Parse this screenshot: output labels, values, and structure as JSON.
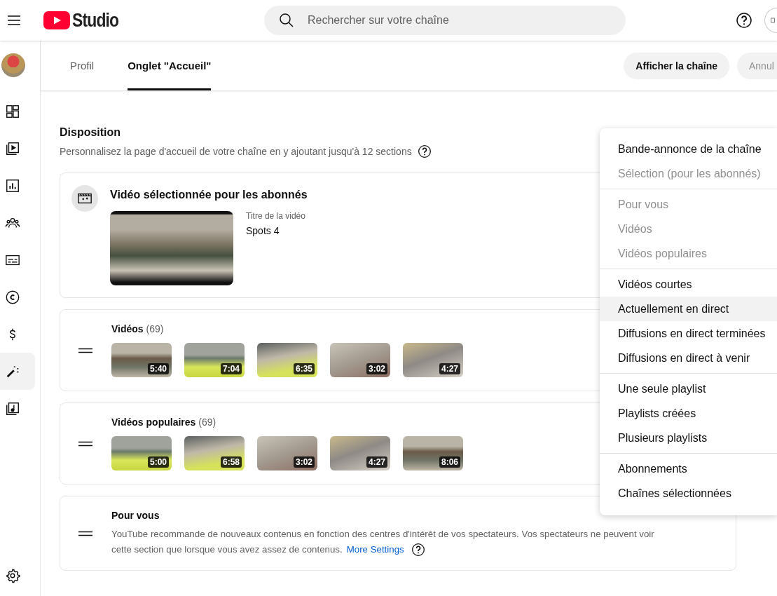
{
  "header": {
    "logo_text": "Studio",
    "search": {
      "placeholder": "Rechercher sur votre chaîne"
    }
  },
  "sidebar": {
    "items": [
      {
        "kind": "dashboard",
        "selected": false
      },
      {
        "kind": "content",
        "selected": false
      },
      {
        "kind": "analytics",
        "selected": false
      },
      {
        "kind": "community",
        "selected": false
      },
      {
        "kind": "subtitles",
        "selected": false
      },
      {
        "kind": "copyright",
        "selected": false
      },
      {
        "kind": "earn",
        "selected": false
      },
      {
        "kind": "customization",
        "selected": true
      },
      {
        "kind": "audio",
        "selected": false
      }
    ]
  },
  "tabs": [
    {
      "label": "Profil",
      "selected": false
    },
    {
      "label": "Onglet \"Accueil\"",
      "selected": true
    }
  ],
  "actions": [
    {
      "label": "Afficher la chaîne",
      "disabled": false
    },
    {
      "label": "Annul",
      "disabled": true
    }
  ],
  "layout": {
    "title": "Disposition",
    "description": "Personnalisez la page d'accueil de votre chaîne en y ajoutant jusqu'à 12 sections",
    "sections": [
      {
        "kind": "featured",
        "title": "Vidéo sélectionnée pour les abonnés",
        "video_label": "Titre de la vidéo",
        "video_title": "Spots 4"
      },
      {
        "kind": "shelf",
        "title": "Vidéos",
        "count": "(69)",
        "durations": [
          "5:40",
          "7:04",
          "6:35",
          "3:02",
          "4:27"
        ]
      },
      {
        "kind": "shelf",
        "title": "Vidéos populaires",
        "count": "(69)",
        "durations": [
          "5:00",
          "6:58",
          "3:02",
          "4:27",
          "8:06"
        ]
      },
      {
        "kind": "info",
        "title": "Pour vous",
        "text": "YouTube recommande de nouveaux contenus en fonction des centres d'intérêt de vos spectateurs. Vos spectateurs ne peuvent voir cette section que lorsque vous avez assez de contenus.",
        "link": "More Settings"
      }
    ]
  },
  "menu": {
    "groups": [
      [
        {
          "label": "Bande-annonce de la chaîne",
          "disabled": false,
          "selected": false
        },
        {
          "label": "Sélection (pour les abonnés)",
          "disabled": true,
          "selected": false
        }
      ],
      [
        {
          "label": "Pour vous",
          "disabled": true,
          "selected": false
        },
        {
          "label": "Vidéos",
          "disabled": true,
          "selected": false
        },
        {
          "label": "Vidéos populaires",
          "disabled": true,
          "selected": false
        }
      ],
      [
        {
          "label": "Vidéos courtes",
          "disabled": false,
          "selected": false
        },
        {
          "label": "Actuellement en direct",
          "disabled": false,
          "selected": true
        },
        {
          "label": "Diffusions en direct terminées",
          "disabled": false,
          "selected": false
        },
        {
          "label": "Diffusions en direct à venir",
          "disabled": false,
          "selected": false
        }
      ],
      [
        {
          "label": "Une seule playlist",
          "disabled": false,
          "selected": false
        },
        {
          "label": "Playlists créées",
          "disabled": false,
          "selected": false
        },
        {
          "label": "Plusieurs playlists",
          "disabled": false,
          "selected": false
        }
      ],
      [
        {
          "label": "Abonnements",
          "disabled": false,
          "selected": false
        },
        {
          "label": "Chaînes sélectionnées",
          "disabled": false,
          "selected": false
        }
      ]
    ]
  }
}
